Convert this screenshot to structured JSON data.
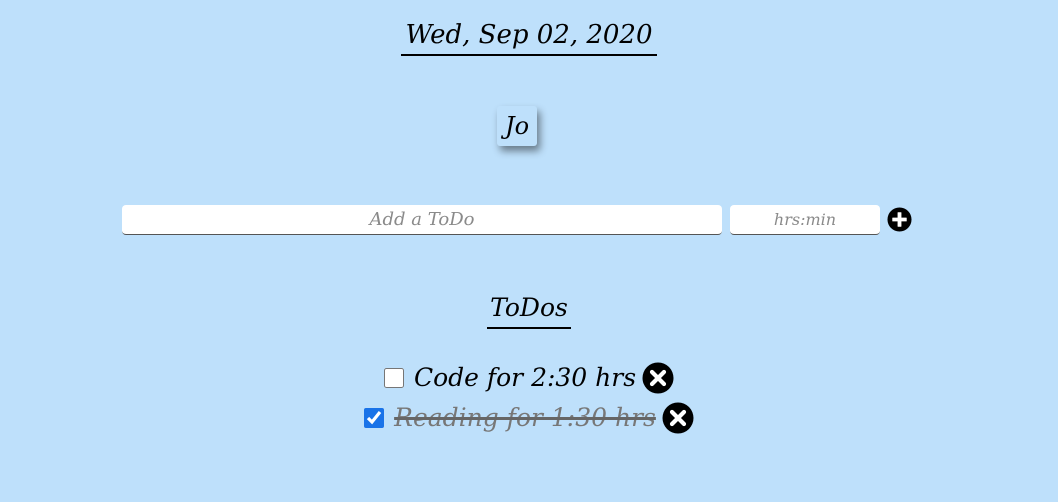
{
  "header": {
    "date": "Wed, Sep 02, 2020",
    "user_initials": "Jo"
  },
  "form": {
    "todo_placeholder": "Add a ToDo",
    "time_placeholder": "hrs:min",
    "add_icon": "plus-circle-icon"
  },
  "todos": {
    "heading": "ToDos",
    "items": [
      {
        "label": "Code for 2:30 hrs",
        "completed": false,
        "delete_icon": "close-circle-icon"
      },
      {
        "label": "Reading for 1:30 hrs",
        "completed": true,
        "delete_icon": "close-circle-icon"
      }
    ]
  },
  "colors": {
    "background": "#bee0fb",
    "checkbox_accent": "#1a73e8",
    "completed_text": "#777777"
  }
}
